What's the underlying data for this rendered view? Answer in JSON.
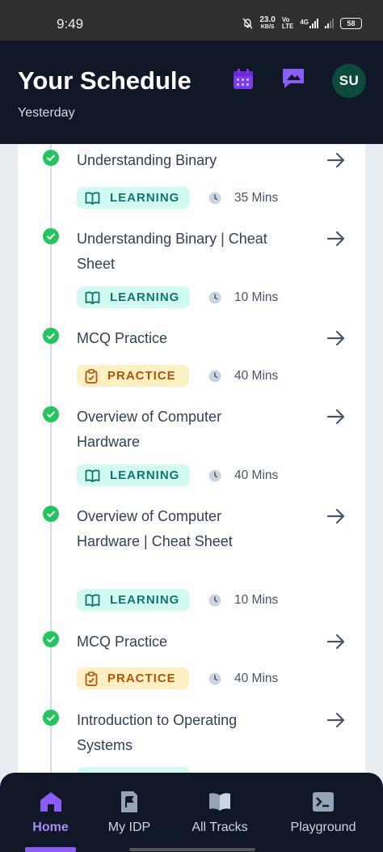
{
  "status_bar": {
    "time": "9:49",
    "net_speed": "23.0",
    "net_unit": "KB/S",
    "volte_top": "Vo",
    "volte_bottom": "LTE",
    "network": "4G",
    "battery": "58"
  },
  "header": {
    "title": "Your Schedule",
    "subtitle": "Yesterday",
    "avatar_initials": "SU",
    "calendar_icon_color": "#7c3aed",
    "message_icon_color": "#8b5cf6"
  },
  "schedule": {
    "items": [
      {
        "title": "Understanding Binary",
        "tag": "LEARNING",
        "duration": "35 Mins",
        "status": "completed"
      },
      {
        "title": "Understanding Binary | Cheat Sheet",
        "tag": "LEARNING",
        "duration": "10 Mins",
        "status": "completed"
      },
      {
        "title": "MCQ Practice",
        "tag": "PRACTICE",
        "duration": "40 Mins",
        "status": "completed"
      },
      {
        "title": "Overview of Computer Hardware",
        "tag": "LEARNING",
        "duration": "40 Mins",
        "status": "completed"
      },
      {
        "title": "Overview of Computer Hardware | Cheat Sheet",
        "tag": "LEARNING",
        "duration": "10 Mins",
        "status": "completed"
      },
      {
        "title": "MCQ Practice",
        "tag": "PRACTICE",
        "duration": "40 Mins",
        "status": "completed"
      },
      {
        "title": "Introduction to Operating Systems",
        "tag": "",
        "duration": "",
        "status": "completed"
      }
    ]
  },
  "colors": {
    "learning_bg": "#d1faf0",
    "learning_text": "#0f766e",
    "practice_bg": "#fdf0c2",
    "practice_text": "#b45309",
    "check": "#22c55e",
    "accent": "#8b5cf6"
  },
  "bottom_nav": {
    "items": [
      {
        "label": "Home",
        "icon": "home-icon",
        "active": true
      },
      {
        "label": "My IDP",
        "icon": "idp-flag-icon",
        "active": false
      },
      {
        "label": "All Tracks",
        "icon": "book-open-icon",
        "active": false
      },
      {
        "label": "Playground",
        "icon": "terminal-icon",
        "active": false
      }
    ]
  }
}
